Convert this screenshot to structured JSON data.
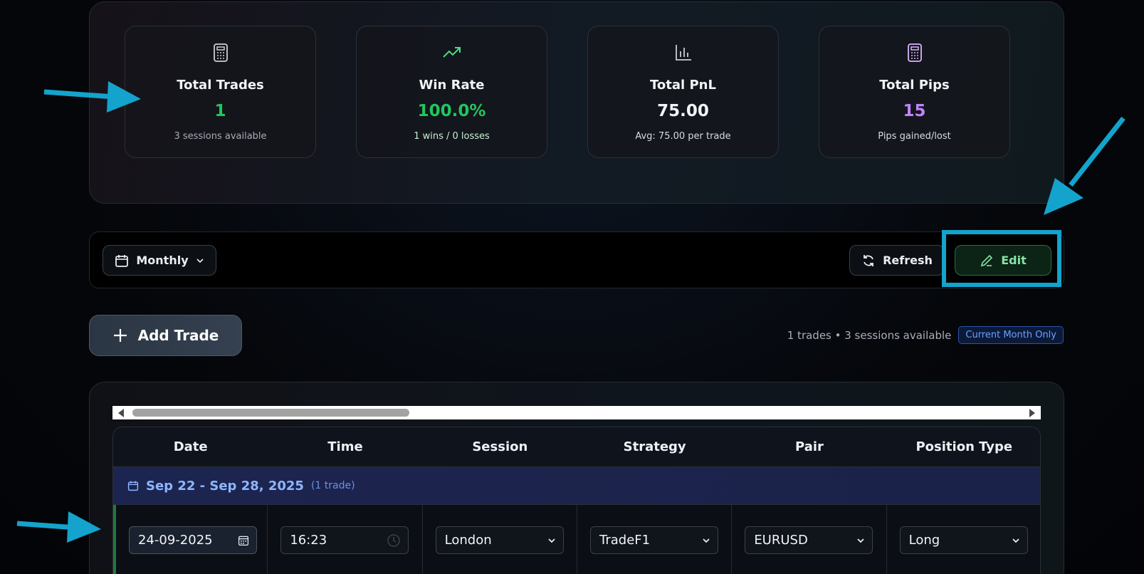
{
  "stats": [
    {
      "icon": "calculator-icon",
      "title": "Total Trades",
      "value": "1",
      "sub": "3 sessions available",
      "value_color": "#22c55e",
      "sub_color": "#a6acb6"
    },
    {
      "icon": "trending-up-icon",
      "title": "Win Rate",
      "value": "100.0%",
      "sub": "1 wins / 0 losses",
      "value_color": "#22c55e",
      "sub_color": "#c8f0d4"
    },
    {
      "icon": "bar-chart-icon",
      "title": "Total PnL",
      "value": "75.00",
      "sub": "Avg: 75.00 per trade",
      "value_color": "#f2f4f7",
      "sub_color": "#d8dbe0"
    },
    {
      "icon": "calculator-icon",
      "title": "Total Pips",
      "value": "15",
      "sub": "Pips gained/lost",
      "value_color": "#c084fc",
      "sub_color": "#d8dbe0"
    }
  ],
  "toolbar": {
    "period_label": "Monthly",
    "refresh_label": "Refresh",
    "edit_label": "Edit"
  },
  "actions": {
    "add_trade_label": "Add Trade",
    "summary_text": "1 trades • 3 sessions available",
    "badge_label": "Current Month Only"
  },
  "table": {
    "columns": [
      "Date",
      "Time",
      "Session",
      "Strategy",
      "Pair",
      "Position Type"
    ],
    "week_group": {
      "range": "Sep 22 - Sep 28, 2025",
      "count": "(1 trade)"
    },
    "row": {
      "date": "24-09-2025",
      "time": "16:23",
      "session": "London",
      "strategy": "TradeF1",
      "pair": "EURUSD",
      "position_type": "Long"
    }
  },
  "colors": {
    "accent_green": "#22c55e",
    "accent_purple": "#c084fc",
    "annotation_blue": "#13a3cc"
  }
}
